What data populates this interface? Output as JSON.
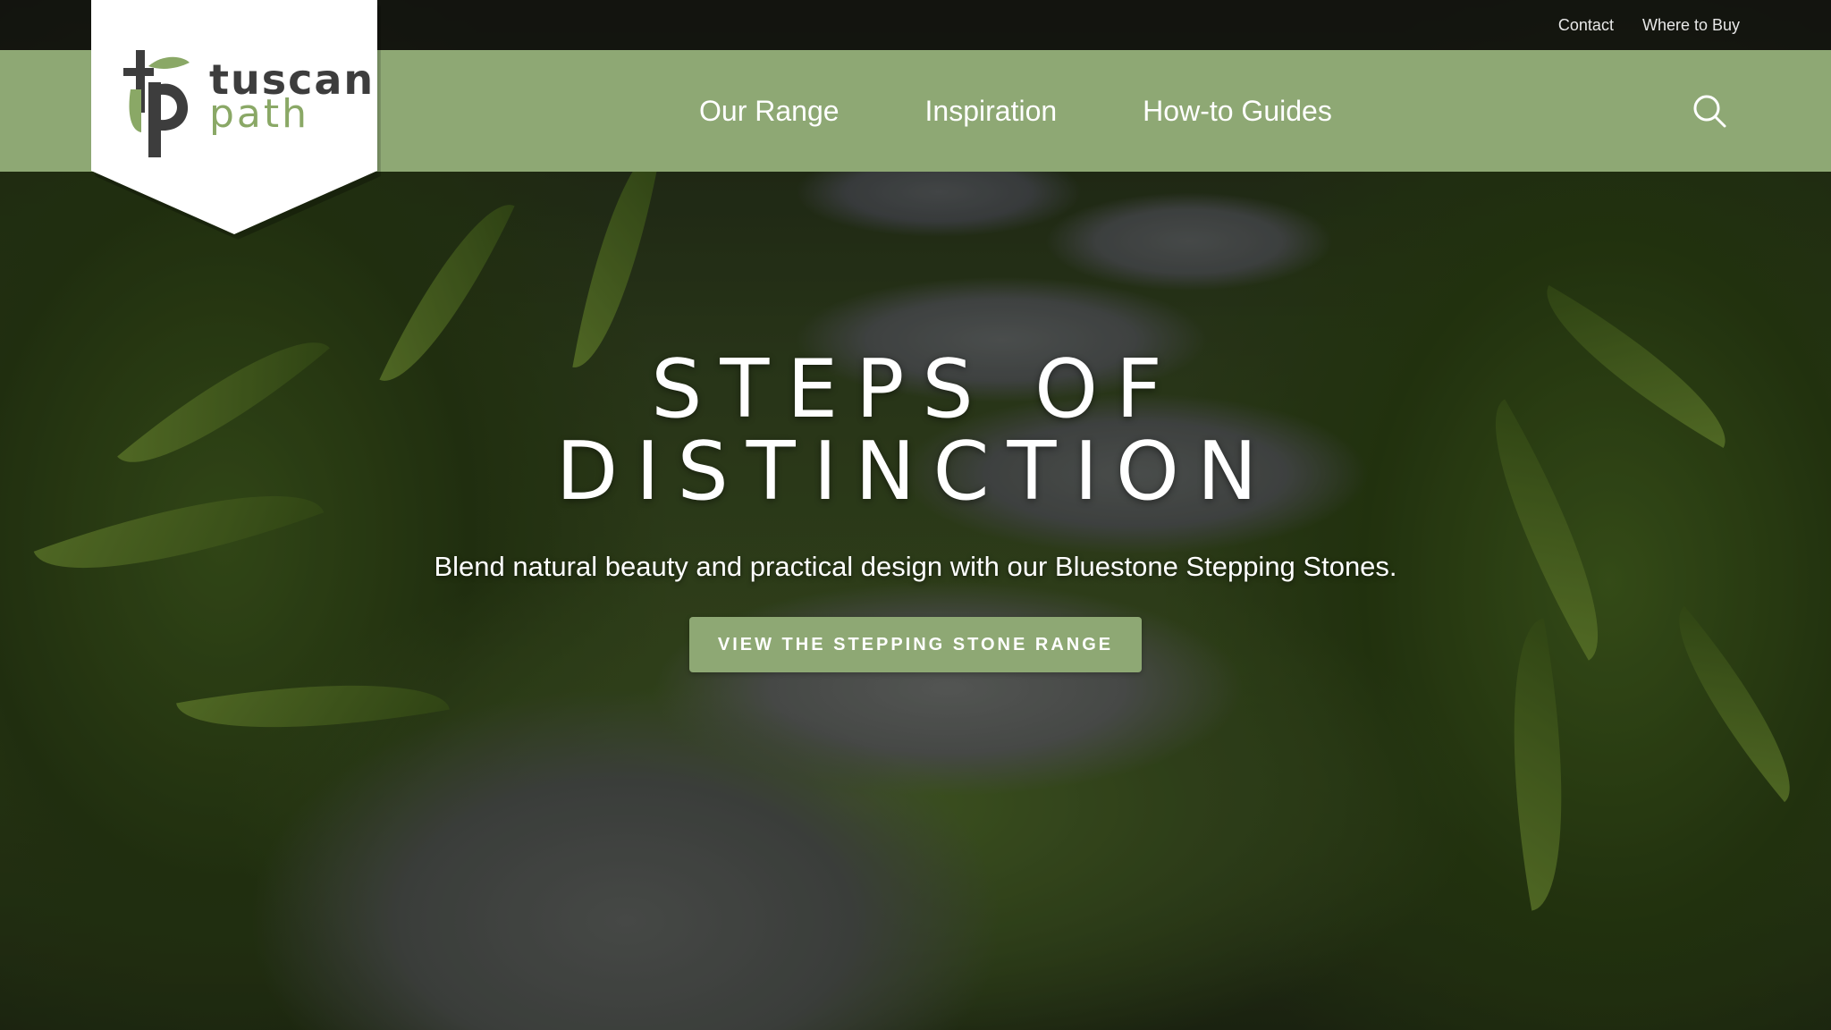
{
  "brand": {
    "name_line1": "tuscan",
    "name_line2": "path",
    "colors": {
      "green": "#8ea874",
      "dark": "#3d3d3d",
      "leaf": "#8aa866"
    }
  },
  "topbar": {
    "links": [
      {
        "label": "Contact"
      },
      {
        "label": "Where to Buy"
      }
    ]
  },
  "nav": {
    "items": [
      {
        "label": "Our Range"
      },
      {
        "label": "Inspiration"
      },
      {
        "label": "How-to Guides"
      }
    ],
    "search_icon": "search-icon"
  },
  "hero": {
    "title_line1": "STEPS OF",
    "title_line2": "DISTINCTION",
    "subtitle": "Blend natural beauty and practical design with our Bluestone Stepping Stones.",
    "cta_label": "VIEW THE STEPPING STONE RANGE"
  }
}
